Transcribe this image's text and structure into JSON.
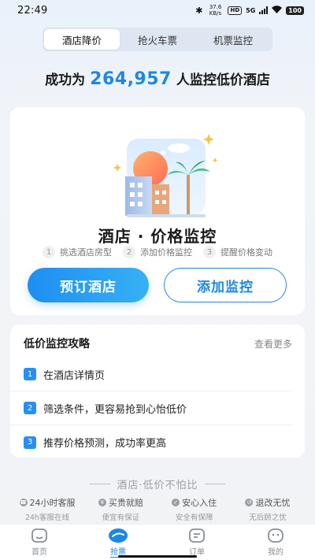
{
  "status_bar": {
    "time": "22:49",
    "network_speed": "37.6 KB/s",
    "hd_badge": "HD",
    "signal_type": "5G",
    "battery": "100"
  },
  "tabs": [
    {
      "label": "酒店降价",
      "active": true
    },
    {
      "label": "抢火车票",
      "active": false
    },
    {
      "label": "机票监控",
      "active": false
    }
  ],
  "headline": {
    "prefix": "成功为",
    "count": "264,957",
    "suffix": "人监控低价酒店"
  },
  "monitor_card": {
    "title": "酒店 · 价格监控",
    "steps": [
      {
        "num": "1",
        "label": "挑选酒店房型"
      },
      {
        "num": "2",
        "label": "添加价格监控"
      },
      {
        "num": "3",
        "label": "提醒价格变动"
      }
    ],
    "book_button": "预订酒店",
    "add_button": "添加监控"
  },
  "guide": {
    "title": "低价监控攻略",
    "more": "查看更多",
    "items": [
      {
        "num": "1",
        "text": "在酒店详情页"
      },
      {
        "num": "2",
        "text": "筛选条件，更容易抢到心怡低价"
      },
      {
        "num": "3",
        "text": "推荐价格预测，成功率更高"
      }
    ]
  },
  "slogan": "酒店·低价不怕比",
  "guarantees": [
    {
      "title": "24小时客服",
      "sub": "24h客服在线"
    },
    {
      "title": "买贵就赔",
      "sub": "便宜有保证"
    },
    {
      "title": "安心入住",
      "sub": "安全有保障"
    },
    {
      "title": "退改无忧",
      "sub": "无后顾之忧"
    }
  ],
  "bottom_nav": [
    {
      "label": "首页",
      "icon": "home-icon",
      "active": false
    },
    {
      "label": "抢票",
      "icon": "ticket-icon",
      "active": true
    },
    {
      "label": "订单",
      "icon": "order-icon",
      "active": false
    },
    {
      "label": "我的",
      "icon": "profile-icon",
      "active": false
    }
  ],
  "colors": {
    "accent": "#1e87e6",
    "background": "#f2f3f5"
  }
}
